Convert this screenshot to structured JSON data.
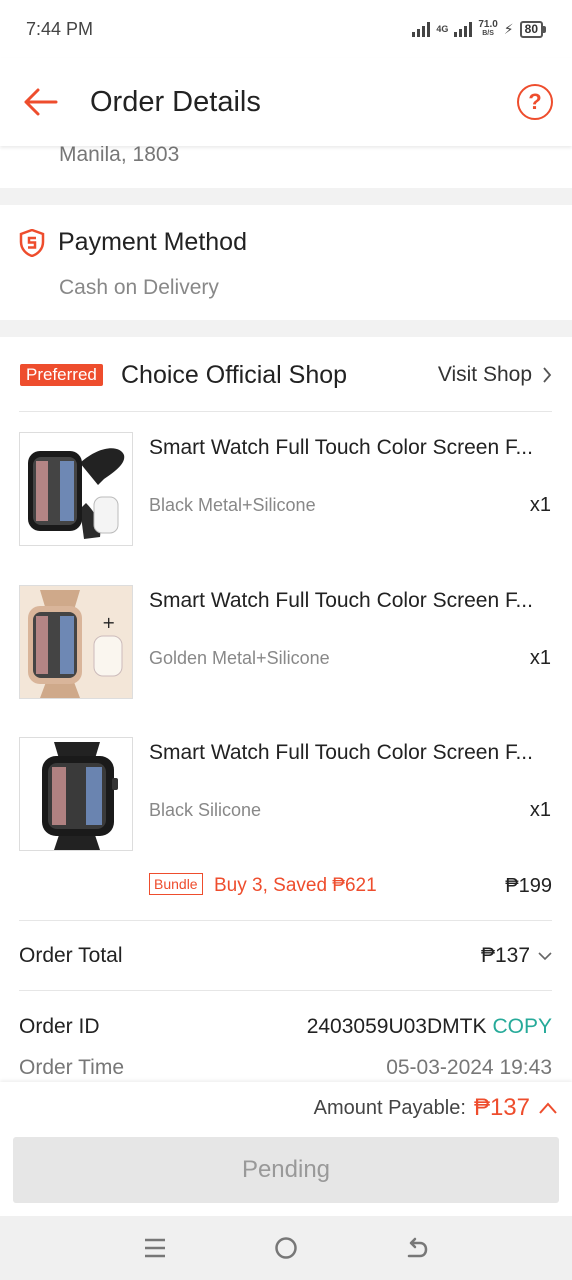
{
  "status_bar": {
    "time": "7:44 PM",
    "network": "4G",
    "speed_value": "71.0",
    "speed_unit": "B/S",
    "battery": "80"
  },
  "header": {
    "title": "Order Details",
    "help_label": "?"
  },
  "address": {
    "tail": "Manila, 1803"
  },
  "payment": {
    "title": "Payment Method",
    "value": "Cash on Delivery"
  },
  "shop": {
    "badge": "Preferred",
    "name": "Choice Official Shop",
    "visit_label": "Visit Shop",
    "items": [
      {
        "name": "Smart Watch Full Touch Color Screen F...",
        "variant": "Black Metal+Silicone",
        "qty": "x1"
      },
      {
        "name": "Smart Watch Full Touch Color Screen F...",
        "variant": "Golden Metal+Silicone",
        "qty": "x1"
      },
      {
        "name": "Smart Watch Full Touch Color Screen F...",
        "variant": "Black Silicone",
        "qty": "x1"
      }
    ],
    "bundle": {
      "badge": "Bundle",
      "text": "Buy 3, Saved ₱621",
      "price": "₱199"
    }
  },
  "order": {
    "total_label": "Order Total",
    "total_value": "₱137",
    "id_label": "Order ID",
    "id_value": "2403059U03DMTK",
    "copy_label": "COPY",
    "time_label": "Order Time",
    "time_value": "05-03-2024 19:43"
  },
  "footer": {
    "payable_label": "Amount Payable:",
    "payable_amount": "₱137",
    "pending_label": "Pending"
  },
  "colors": {
    "accent": "#ee4d2d",
    "copy": "#26aa99"
  }
}
